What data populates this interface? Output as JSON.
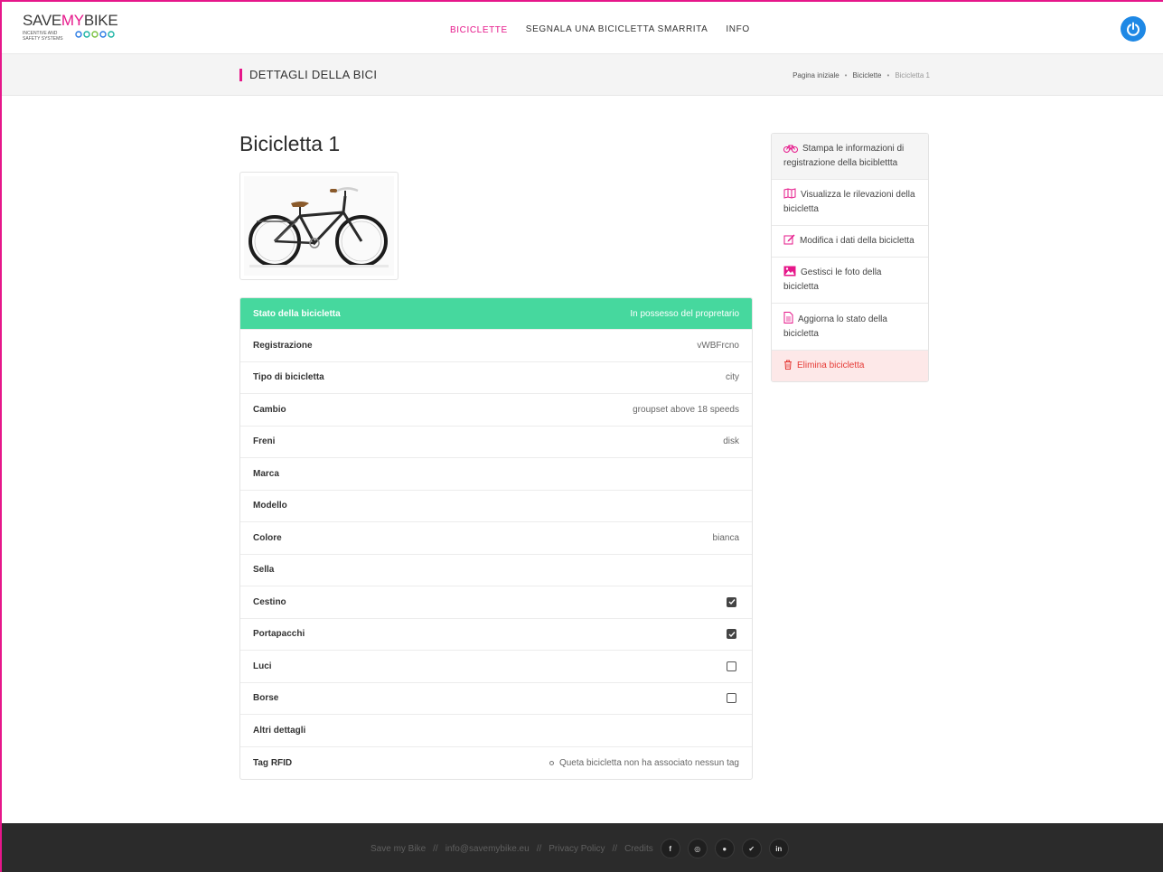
{
  "brand": {
    "logo_main_prefix": "SAVE",
    "logo_main_accent": "MY",
    "logo_main_suffix": "BIKE",
    "logo_sub": "INCENTIVE AND SAFETY SYSTEMS",
    "accent_color": "#e6178a"
  },
  "nav": {
    "items": [
      {
        "label": "BICICLETTE",
        "active": true
      },
      {
        "label": "SEGNALA UNA BICICLETTA SMARRITA",
        "active": false
      },
      {
        "label": "INFO",
        "active": false
      }
    ],
    "power_icon": "power-icon",
    "power_color": "#1e88e5"
  },
  "titlebar": {
    "heading": "DETTAGLI DELLA BICI",
    "breadcrumb": [
      "Pagina iniziale",
      "Biciclette",
      "Bicicletta 1"
    ],
    "separator": "•"
  },
  "bike": {
    "title": "Bicicletta 1",
    "photo_alt": "bike-photo"
  },
  "details": {
    "status": {
      "label": "Stato della bicicletta",
      "value": "In possesso del propretario",
      "color": "#46d89e"
    },
    "rows": [
      {
        "label": "Registrazione",
        "value": "vWBFrcno"
      },
      {
        "label": "Tipo di bicicletta",
        "value": "city"
      },
      {
        "label": "Cambio",
        "value": "groupset above 18 speeds"
      },
      {
        "label": "Freni",
        "value": "disk"
      },
      {
        "label": "Marca",
        "value": ""
      },
      {
        "label": "Modello",
        "value": ""
      },
      {
        "label": "Colore",
        "value": "bianca"
      },
      {
        "label": "Sella",
        "value": ""
      }
    ],
    "checkbox_rows": [
      {
        "label": "Cestino",
        "checked": true
      },
      {
        "label": "Portapacchi",
        "checked": true
      },
      {
        "label": "Luci",
        "checked": false
      },
      {
        "label": "Borse",
        "checked": false
      }
    ],
    "extra_rows": [
      {
        "label": "Altri dettagli",
        "value": ""
      }
    ],
    "rfid": {
      "label": "Tag RFID",
      "value": "Queta bicicletta non ha associato nessun tag"
    }
  },
  "actions": [
    {
      "label": "Stampa le informazioni di registrazione della biciblettta",
      "icon": "bicycle-icon"
    },
    {
      "label": "Visualizza le rilevazioni della bicicletta",
      "icon": "map-icon"
    },
    {
      "label": "Modifica i dati della bicicletta",
      "icon": "edit-icon"
    },
    {
      "label": "Gestisci le foto della bicicletta",
      "icon": "image-icon"
    },
    {
      "label": "Aggiorna lo stato della bicicletta",
      "icon": "document-icon"
    },
    {
      "label": "Elimina bicicletta",
      "icon": "trash-icon",
      "danger": true
    }
  ],
  "footer": {
    "brand": "Save my Bike",
    "email": "info@savemybike.eu",
    "privacy": "Privacy Policy",
    "credits": "Credits",
    "separator": "//",
    "social": [
      {
        "icon": "facebook-icon",
        "glyph": "f"
      },
      {
        "icon": "instagram-icon",
        "glyph": "◎"
      },
      {
        "icon": "pinterest-icon",
        "glyph": "●"
      },
      {
        "icon": "twitter-icon",
        "glyph": "✔"
      },
      {
        "icon": "linkedin-icon",
        "glyph": "in"
      }
    ]
  }
}
